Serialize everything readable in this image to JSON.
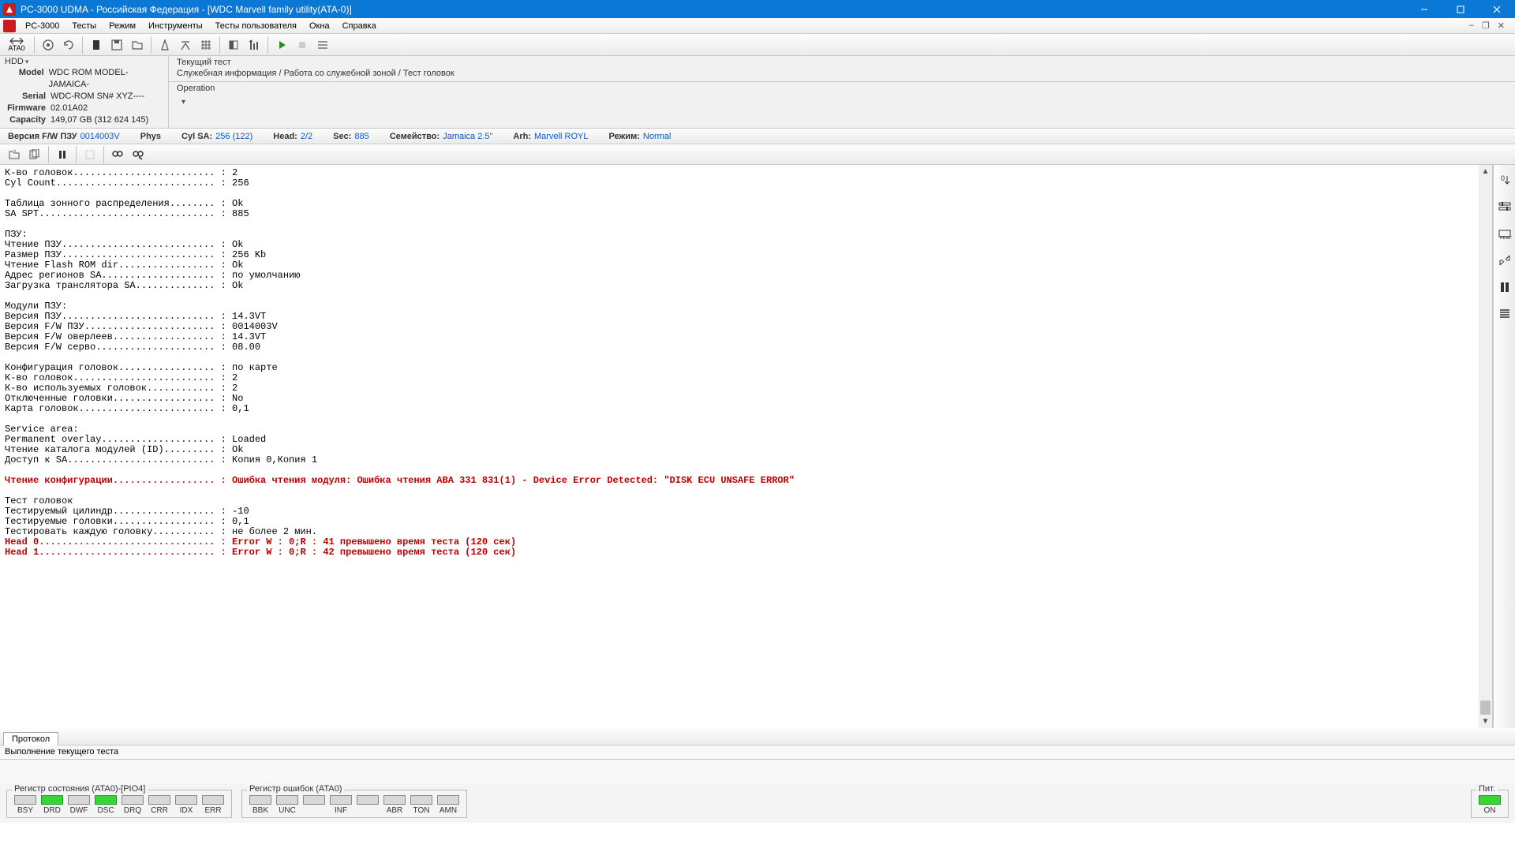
{
  "title": "PC-3000 UDMA - Российская Федерация - [WDC Marvell family utility(ATA-0)]",
  "menu": {
    "app": "PC-3000",
    "tests": "Тесты",
    "mode": "Режим",
    "tools": "Инструменты",
    "usertests": "Тесты пользователя",
    "windows": "Окна",
    "help": "Справка"
  },
  "toolbar": {
    "ata": "ATA0"
  },
  "hdd": {
    "header": "HDD",
    "model_l": "Model",
    "model": "WDC ROM MODEL-JAMAICA-",
    "serial_l": "Serial",
    "serial": "WDC-ROM SN# XYZ----",
    "fw_l": "Firmware",
    "fw": "02.01A02",
    "cap_l": "Capacity",
    "cap": "149,07 GB (312 624 145)"
  },
  "test": {
    "cur_title": "Текущий тест",
    "breadcrumb": "Служебная информация / Работа со служебной зоной / Тест головок",
    "op_title": "Operation"
  },
  "params": {
    "fwver_l": "Версия F/W ПЗУ",
    "fwver": "0014003V",
    "phys": "Phys",
    "cylsa_l": "Cyl SA:",
    "cylsa": "256 (122)",
    "head_l": "Head:",
    "head": "2/2",
    "sec_l": "Sec:",
    "sec": "885",
    "fam_l": "Семейство:",
    "fam": "Jamaica 2.5\"",
    "arh_l": "Arh:",
    "arh": "Marvell ROYL",
    "mode_l": "Режим:",
    "mode": "Normal"
  },
  "log": {
    "lines": [
      {
        "t": "К-во головок......................... : 2"
      },
      {
        "t": "Cyl Count............................ : 256"
      },
      {
        "t": ""
      },
      {
        "t": "Таблица зонного распределения........ : Ok"
      },
      {
        "t": "SA SPT............................... : 885"
      },
      {
        "t": ""
      },
      {
        "t": "ПЗУ:"
      },
      {
        "t": "Чтение ПЗУ........................... : Ok"
      },
      {
        "t": "Размер ПЗУ........................... : 256 Kb"
      },
      {
        "t": "Чтение Flash ROM dir................. : Ok"
      },
      {
        "t": "Адрес регионов SA.................... : по умолчанию"
      },
      {
        "t": "Загрузка транслятора SA.............. : Ok"
      },
      {
        "t": ""
      },
      {
        "t": "Модули ПЗУ:"
      },
      {
        "t": "Версия ПЗУ........................... : 14.3VT"
      },
      {
        "t": "Версия F/W ПЗУ....................... : 0014003V"
      },
      {
        "t": "Версия F/W оверлеев.................. : 14.3VT"
      },
      {
        "t": "Версия F/W серво..................... : 08.00"
      },
      {
        "t": ""
      },
      {
        "t": "Конфигурация головок................. : по карте"
      },
      {
        "t": "К-во головок......................... : 2"
      },
      {
        "t": "К-во используемых головок............ : 2"
      },
      {
        "t": "Отключенные головки.................. : No"
      },
      {
        "t": "Карта головок........................ : 0,1"
      },
      {
        "t": ""
      },
      {
        "t": "Service area:"
      },
      {
        "t": "Permanent overlay.................... : Loaded"
      },
      {
        "t": "Чтение каталога модулей (ID)......... : Ok"
      },
      {
        "t": "Доступ к SA.......................... : Копия 0,Копия 1"
      },
      {
        "t": ""
      },
      {
        "t": "Чтение конфигурации.................. : Ошибка чтения модуля: Ошибка чтения ABA 331 831(1) - Device Error Detected: \"DISK ECU UNSAFE ERROR\"",
        "c": "red"
      },
      {
        "t": ""
      },
      {
        "t": "Тест головок"
      },
      {
        "t": "Тестируемый цилиндр.................. : -10"
      },
      {
        "t": "Тестируемые головки.................. : 0,1"
      },
      {
        "t": "Тестировать каждую головку........... : не более 2 мин."
      },
      {
        "t": "Head 0............................... : Error W : 0;R : 41 превышено время теста (120 сек)",
        "c": "red"
      },
      {
        "t": "Head 1............................... : Error W : 0;R : 42 превышено время теста (120 сек)",
        "c": "red"
      }
    ]
  },
  "proto_tab": "Протокол",
  "exec_msg": "Выполнение текущего теста",
  "status": {
    "g1": "Регистр состояния (ATA0)-[PIO4]",
    "g2": "Регистр ошибок  (ATA0)",
    "g3": "Пит.",
    "r1": [
      {
        "n": "BSY",
        "on": false
      },
      {
        "n": "DRD",
        "on": true
      },
      {
        "n": "DWF",
        "on": false
      },
      {
        "n": "DSC",
        "on": true
      },
      {
        "n": "DRQ",
        "on": false
      },
      {
        "n": "CRR",
        "on": false
      },
      {
        "n": "IDX",
        "on": false
      },
      {
        "n": "ERR",
        "on": false
      }
    ],
    "r2": [
      {
        "n": "BBK",
        "on": false
      },
      {
        "n": "UNC",
        "on": false
      },
      {
        "n": "",
        "on": false
      },
      {
        "n": "INF",
        "on": false
      },
      {
        "n": "",
        "on": false
      },
      {
        "n": "ABR",
        "on": false
      },
      {
        "n": "TON",
        "on": false
      },
      {
        "n": "AMN",
        "on": false
      }
    ],
    "r3": [
      {
        "n": "ON",
        "on": true
      }
    ]
  }
}
